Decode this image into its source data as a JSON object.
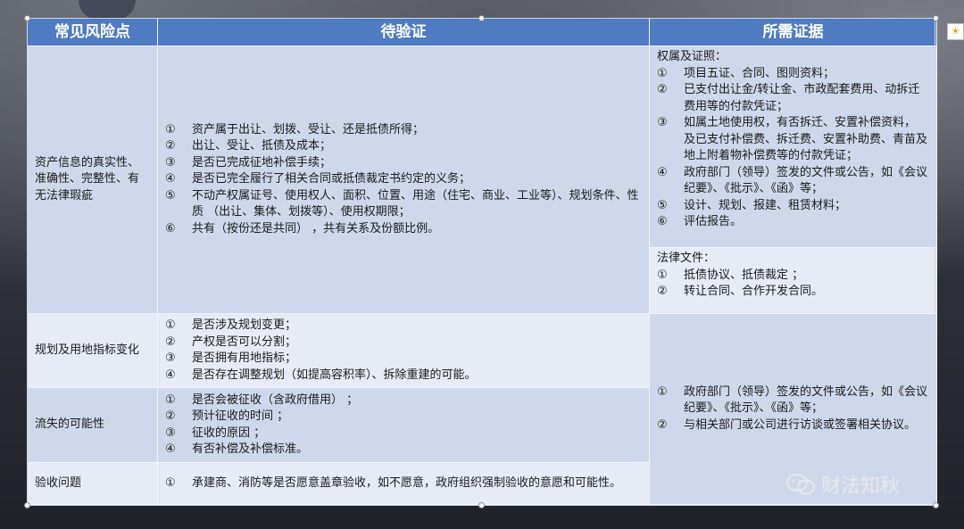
{
  "table": {
    "headers": [
      "常见风险点",
      "待验证",
      "所需证据"
    ],
    "rows": [
      {
        "risk": "资产信息的真实性、准确性、完整性、有无法律瑕疵",
        "verify": [
          {
            "n": "①",
            "t": "资产属于出让、划拨、受让、还是抵债所得；"
          },
          {
            "n": "②",
            "t": "出让、受让、抵债及成本；"
          },
          {
            "n": "③",
            "t": "是否已完成征地补偿手续；"
          },
          {
            "n": "④",
            "t": "是否已完全履行了相关合同或抵债裁定书约定的义务；"
          },
          {
            "n": "⑤",
            "t": "不动产权属证号、使用权人、面积、位置、用途（住宅、商业、工业等）、规划条件、性质 （出让、集体、划拨等）、使用权期限；"
          },
          {
            "n": "⑥",
            "t": "共有（按份还是共同） ，共有关系及份额比例。"
          }
        ]
      },
      {
        "risk": "规划及用地指标变化",
        "verify": [
          {
            "n": "①",
            "t": "是否涉及规划变更；"
          },
          {
            "n": "②",
            "t": "产权是否可以分割；"
          },
          {
            "n": "③",
            "t": "是否拥有用地指标；"
          },
          {
            "n": "④",
            "t": "是否存在调整规划（如提高容积率）、拆除重建的可能。"
          }
        ]
      },
      {
        "risk": "流失的可能性",
        "verify": [
          {
            "n": "①",
            "t": "是否会被征收（含政府借用） ；"
          },
          {
            "n": "②",
            "t": "预计征收的时间 ；"
          },
          {
            "n": "③",
            "t": "征收的原因 ；"
          },
          {
            "n": "④",
            "t": "有否补偿及补偿标准。"
          }
        ]
      },
      {
        "risk": "验收问题",
        "verify": [
          {
            "n": "①",
            "t": "承建商、消防等是否愿意盖章验收，如不愿意，政府组织强制验收的意愿和可能性。"
          }
        ]
      }
    ],
    "evidence_1": {
      "title_a": "权属及证照：",
      "items_a": [
        {
          "n": "①",
          "t": "项目五证、合同、图则资料；"
        },
        {
          "n": "②",
          "t": "已支付出让金/转让金、市政配套费用、动拆迁费用等的付款凭证；"
        },
        {
          "n": "③",
          "t": "如属土地使用权，有否拆迁、安置补偿资料， 及已支付补偿费、拆迁费、安置补助费、青苗及地上附着物补偿费等的付款凭证；"
        },
        {
          "n": "④",
          "t": "政府部门（领导）签发的文件或公告，如《会议纪要》、《批示》、《函》等；"
        },
        {
          "n": "⑤",
          "t": "设计、规划、报建、租赁材料；"
        },
        {
          "n": "⑥",
          "t": "评估报告。"
        }
      ],
      "title_b": "法律文件：",
      "items_b": [
        {
          "n": "①",
          "t": "抵债协议、抵债裁定 ；"
        },
        {
          "n": "②",
          "t": "转让合同、合作开发合同。"
        }
      ]
    },
    "evidence_2": [
      {
        "n": "①",
        "t": "政府部门（领导）签发的文件或公告，如《会议纪要》、《批示》、《函》等；"
      },
      {
        "n": "②",
        "t": "与相关部门或公司进行访谈或签署相关协议。"
      }
    ]
  },
  "watermark": "财法知秋"
}
